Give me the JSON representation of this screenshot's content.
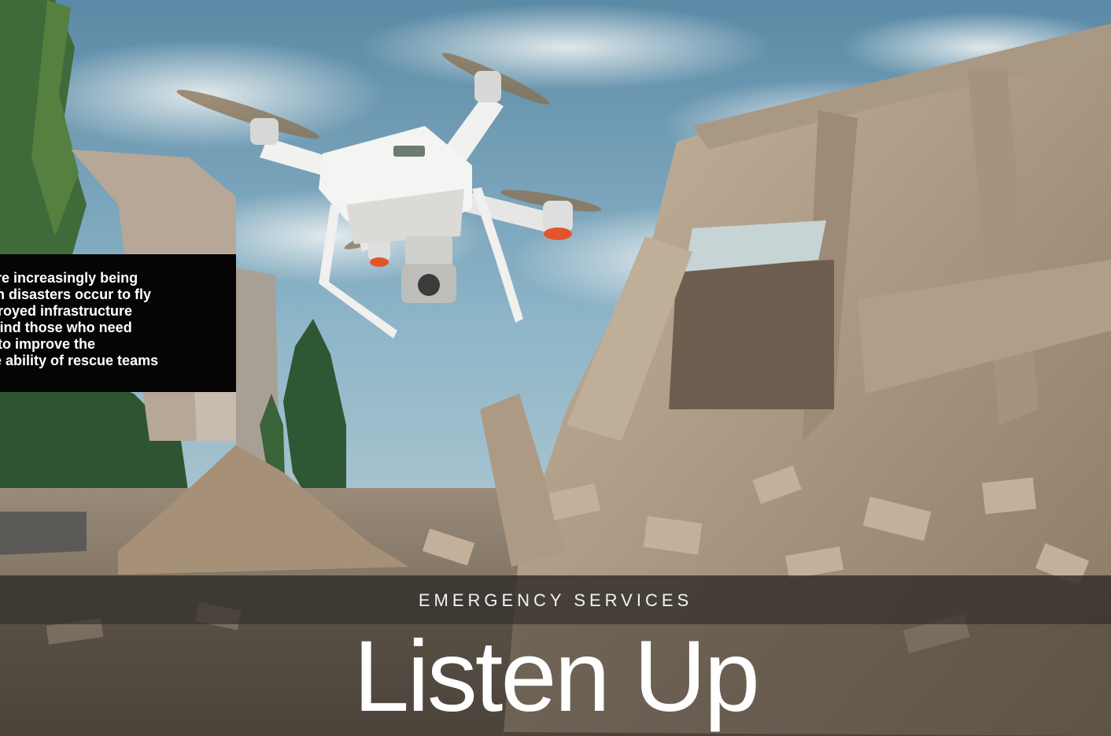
{
  "article": {
    "section": "EMERGENCY SERVICES",
    "headline": "Listen Up",
    "caption": "es are increasingly being when disasters occur to fly destroyed infrastructure kly, find those who need and to improve the onse ability of rescue teams"
  },
  "caption_lines": [
    "es are increasingly being",
    " when disasters occur to fly",
    "destroyed infrastructure",
    "kly, find those who need",
    " and to improve the",
    "onse ability of rescue teams"
  ],
  "scene": {
    "subject": "white quadcopter drone",
    "setting": "collapsed concrete building rubble"
  },
  "colors": {
    "sky": "#6e9db8",
    "rubble": "#b8a48e",
    "caption_bg": "#050505",
    "text": "#ffffff"
  }
}
